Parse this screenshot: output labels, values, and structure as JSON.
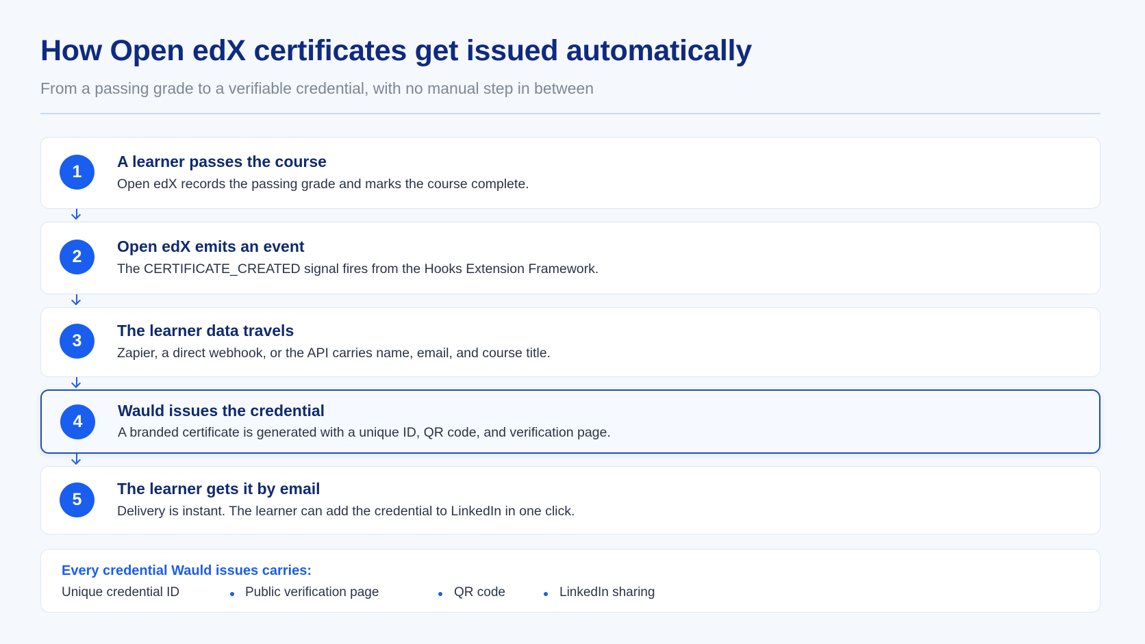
{
  "header": {
    "title": "How Open edX certificates get issued automatically",
    "subtitle": "From a passing grade to a verifiable credential, with no manual step in between"
  },
  "steps": [
    {
      "number": "1",
      "title": "A learner passes the course",
      "description": "Open edX records the passing grade and marks the course complete."
    },
    {
      "number": "2",
      "title": "Open edX emits an event",
      "description": "The CERTIFICATE_CREATED signal fires from the Hooks Extension Framework."
    },
    {
      "number": "3",
      "title": "The learner data travels",
      "description": "Zapier, a direct webhook, or the API carries name, email, and course title."
    },
    {
      "number": "4",
      "title": "Wauld issues the credential",
      "description": "A branded certificate is generated with a unique ID, QR code, and verification page.",
      "highlighted": true
    },
    {
      "number": "5",
      "title": "The learner gets it by email",
      "description": "Delivery is instant. The learner can add the credential to LinkedIn in one click."
    }
  ],
  "summary": {
    "title": "Every credential Wauld issues carries:",
    "features": [
      "Unique credential ID",
      "Public verification page",
      "QR code",
      "LinkedIn sharing"
    ]
  },
  "colors": {
    "accent": "#1a5ef0",
    "title": "#0f2a80",
    "highlight_border": "#1f4fb0",
    "background": "#f5f8fc"
  }
}
